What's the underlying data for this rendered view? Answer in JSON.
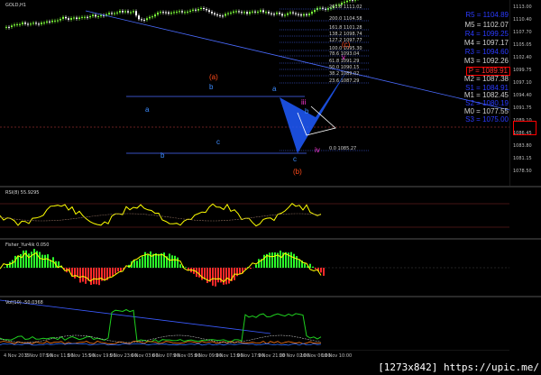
{
  "app": {
    "symbol_label": "GOLD,H1"
  },
  "indicators": {
    "rsi_label": "RSI(8) 55.9295",
    "fisher_label": "Fisher_Yur4ik 0.050",
    "vol_label": "Vol(10) -50.0368"
  },
  "watermark": "[1273x842] https://upic.me/",
  "pivots": [
    {
      "label": "R5 = 1104.89",
      "color": "#2b3bff"
    },
    {
      "label": "M5 = 1102.07",
      "color": "#d0d0d0"
    },
    {
      "label": "R4 = 1099.25",
      "color": "#2b3bff"
    },
    {
      "label": "M4 = 1097.17",
      "color": "#d0d0d0"
    },
    {
      "label": "R3 = 1094.60",
      "color": "#2b3bff"
    },
    {
      "label": "M3 = 1092.26",
      "color": "#d0d0d0"
    },
    {
      "label": "P = 1089.91",
      "color": "#ff3030",
      "boxed": true
    },
    {
      "label": "M2 = 1087.38",
      "color": "#d0d0d0"
    },
    {
      "label": "S1 = 1084.91",
      "color": "#2b3bff"
    },
    {
      "label": "M1 = 1082.45",
      "color": "#d0d0d0"
    },
    {
      "label": "S2 = 1080.19",
      "color": "#2b3bff"
    },
    {
      "label": "M0 = 1077.55",
      "color": "#d0d0d0"
    },
    {
      "label": "S3 = 1075.00",
      "color": "#2b3bff"
    }
  ],
  "wave_labels": [
    {
      "text": "(a)",
      "color": "#ff4a1a"
    },
    {
      "text": "(b)",
      "color": "#ff4a1a"
    },
    {
      "text": "(c)",
      "color": "#ff4a1a"
    },
    {
      "text": "a",
      "color": "#3d8cff"
    },
    {
      "text": "b",
      "color": "#3d8cff"
    },
    {
      "text": "c",
      "color": "#3d8cff"
    },
    {
      "text": "a",
      "color": "#3d8cff"
    },
    {
      "text": "b",
      "color": "#3d8cff"
    },
    {
      "text": "c",
      "color": "#3d8cff"
    },
    {
      "text": "iii",
      "color": "#ff3ad8"
    },
    {
      "text": "iv",
      "color": "#ff3ad8"
    },
    {
      "text": "v",
      "color": "#ff3ad8"
    }
  ],
  "fib_levels": [
    "261.8 1111.02",
    "200.0 1104.58",
    "161.8 1101.28",
    "138.2 1098.74",
    "127.2 1097.77",
    "100.0 1095.30",
    "78.6 1093.04",
    "61.8 1091.29",
    "50.0 1090.15",
    "38.2 1089.02",
    "23.6 1087.29",
    "0.0 1085.27"
  ],
  "price_axis": [
    "1113.00",
    "1110.40",
    "1107.70",
    "1105.05",
    "1102.40",
    "1099.75",
    "1097.10",
    "1094.40",
    "1091.75",
    "1089.10",
    "1086.45",
    "1083.80",
    "1081.15",
    "1078.50"
  ],
  "time_axis": [
    "4 Nov 2015",
    "5 Nov 07:00",
    "5 Nov 11:00",
    "5 Nov 15:00",
    "5 Nov 19:00",
    "5 Nov 23:00",
    "6 Nov 03:00",
    "6 Nov 07:00",
    "9 Nov 05:00",
    "9 Nov 09:00",
    "9 Nov 13:00",
    "9 Nov 17:00",
    "9 Nov 21:00",
    "10 Nov 02:00",
    "10 Nov 06:00",
    "10 Nov 10:00"
  ],
  "colors": {
    "bull": "#7dfc3a",
    "bear": "#ffffff",
    "trend": "#4a6bff",
    "fib": "#4a6bff",
    "rsi": "#ffff00",
    "fisher": "#ffff00",
    "vol_main": "#1fd01f"
  }
}
